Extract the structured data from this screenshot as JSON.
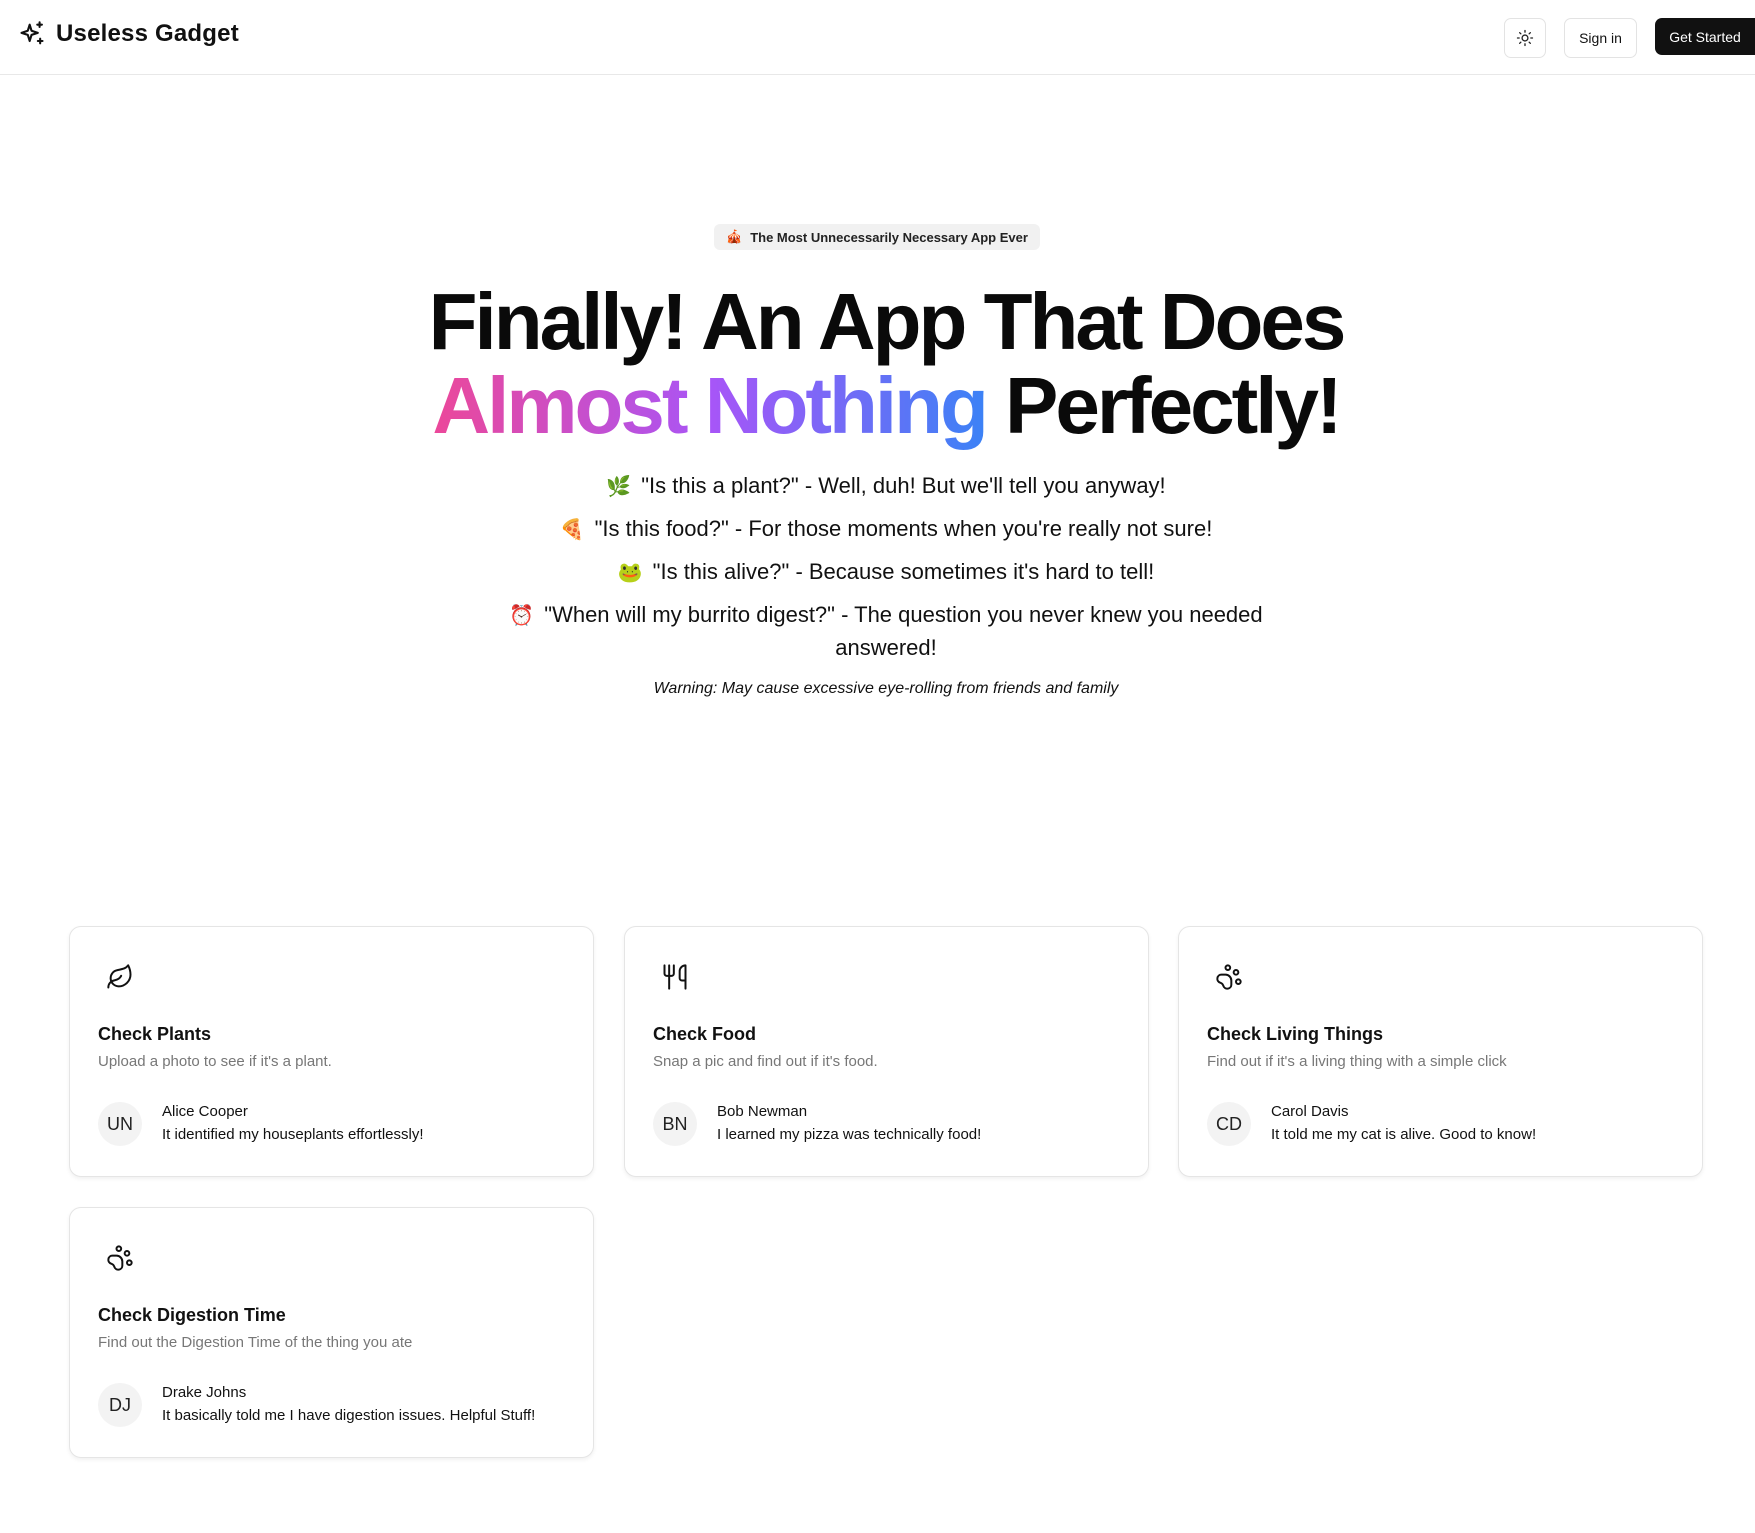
{
  "header": {
    "brand_name": "Useless Gadget",
    "brand_icon": "sparkles-icon",
    "theme_icon": "sun-icon",
    "sign_in_label": "Sign in",
    "get_started_label": "Get Started"
  },
  "hero": {
    "badge_emoji": "🎪",
    "badge_text": "The Most Unnecessarily Necessary App Ever",
    "headline_line1": "Finally! An App That Does",
    "headline_gradient": "Almost Nothing",
    "headline_end": " Perfectly!",
    "gradient_colors": [
      "#ec4899",
      "#a855f7",
      "#3b82f6"
    ],
    "taglines": [
      {
        "emoji": "🌿",
        "text": "\"Is this a plant?\" - Well, duh! But we'll tell you anyway!"
      },
      {
        "emoji": "🍕",
        "text": "\"Is this food?\" - For those moments when you're really not sure!"
      },
      {
        "emoji": "🐸",
        "text": "\"Is this alive?\" - Because sometimes it's hard to tell!"
      },
      {
        "emoji": "⏰",
        "text": "\"When will my burrito digest?\" - The question you never knew you needed answered!"
      }
    ],
    "warning": "Warning: May cause excessive eye-rolling from friends and family"
  },
  "cards": [
    {
      "icon": "leaf-icon",
      "title": "Check Plants",
      "description": "Upload a photo to see if it's a plant.",
      "avatar_initials": "UN",
      "reviewer": "Alice Cooper",
      "review": "It identified my houseplants effortlessly!"
    },
    {
      "icon": "utensils-icon",
      "title": "Check Food",
      "description": "Snap a pic and find out if it's food.",
      "avatar_initials": "BN",
      "reviewer": "Bob Newman",
      "review": "I learned my pizza was technically food!"
    },
    {
      "icon": "paw-icon",
      "title": "Check Living Things",
      "description": "Find out if it's a living thing with a simple click",
      "avatar_initials": "CD",
      "reviewer": "Carol Davis",
      "review": "It told me my cat is alive. Good to know!"
    },
    {
      "icon": "paw-icon",
      "title": "Check Digestion Time",
      "description": "Find out the Digestion Time of the thing you ate",
      "avatar_initials": "DJ",
      "reviewer": "Drake Johns",
      "review": "It basically told me I have digestion issues. Helpful Stuff!"
    }
  ]
}
